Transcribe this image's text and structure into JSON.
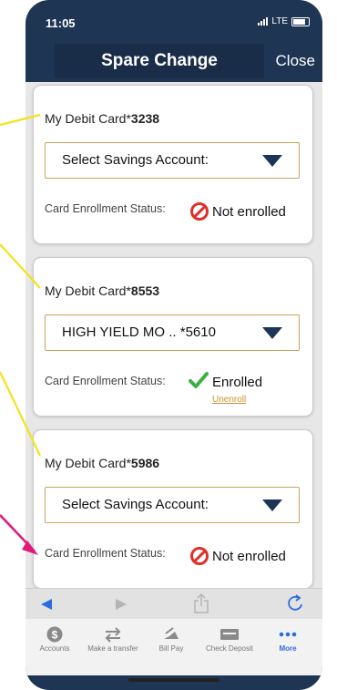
{
  "status_bar": {
    "time": "11:05",
    "network": "LTE"
  },
  "header": {
    "title": "Spare Change",
    "close_label": "Close"
  },
  "cards": [
    {
      "card_prefix": "My Debit Card*",
      "card_number": "3238",
      "select_value": "Select Savings Account:",
      "status_label": "Card Enrollment Status:",
      "status_value": "Not enrolled",
      "enrolled": false
    },
    {
      "card_prefix": "My Debit Card*",
      "card_number": "8553",
      "select_value": "HIGH YIELD MO .. *5610",
      "status_label": "Card Enrollment Status:",
      "status_value": "Enrolled",
      "enrolled": true,
      "unenroll_label": "Unenroll"
    },
    {
      "card_prefix": "My Debit Card*",
      "card_number": "5986",
      "select_value": "Select Savings Account:",
      "status_label": "Card Enrollment Status:",
      "status_value": "Not enrolled",
      "enrolled": false
    }
  ],
  "tabs": [
    {
      "label": "Accounts",
      "icon": "dollar-icon"
    },
    {
      "label": "Make a transfer",
      "icon": "transfer-arrows-icon"
    },
    {
      "label": "Bill Pay",
      "icon": "bill-pay-icon"
    },
    {
      "label": "Check Deposit",
      "icon": "check-deposit-icon"
    },
    {
      "label": "More",
      "icon": "more-dots-icon",
      "active": true
    }
  ],
  "colors": {
    "navy": "#1f3554",
    "gold_border": "#c8a25a",
    "error_red": "#e0302a",
    "success_green": "#3cb043",
    "link_gold": "#c9952e",
    "active_blue": "#2d6cdf",
    "callout_yellow": "#f4e21a",
    "callout_magenta": "#e0197d"
  }
}
